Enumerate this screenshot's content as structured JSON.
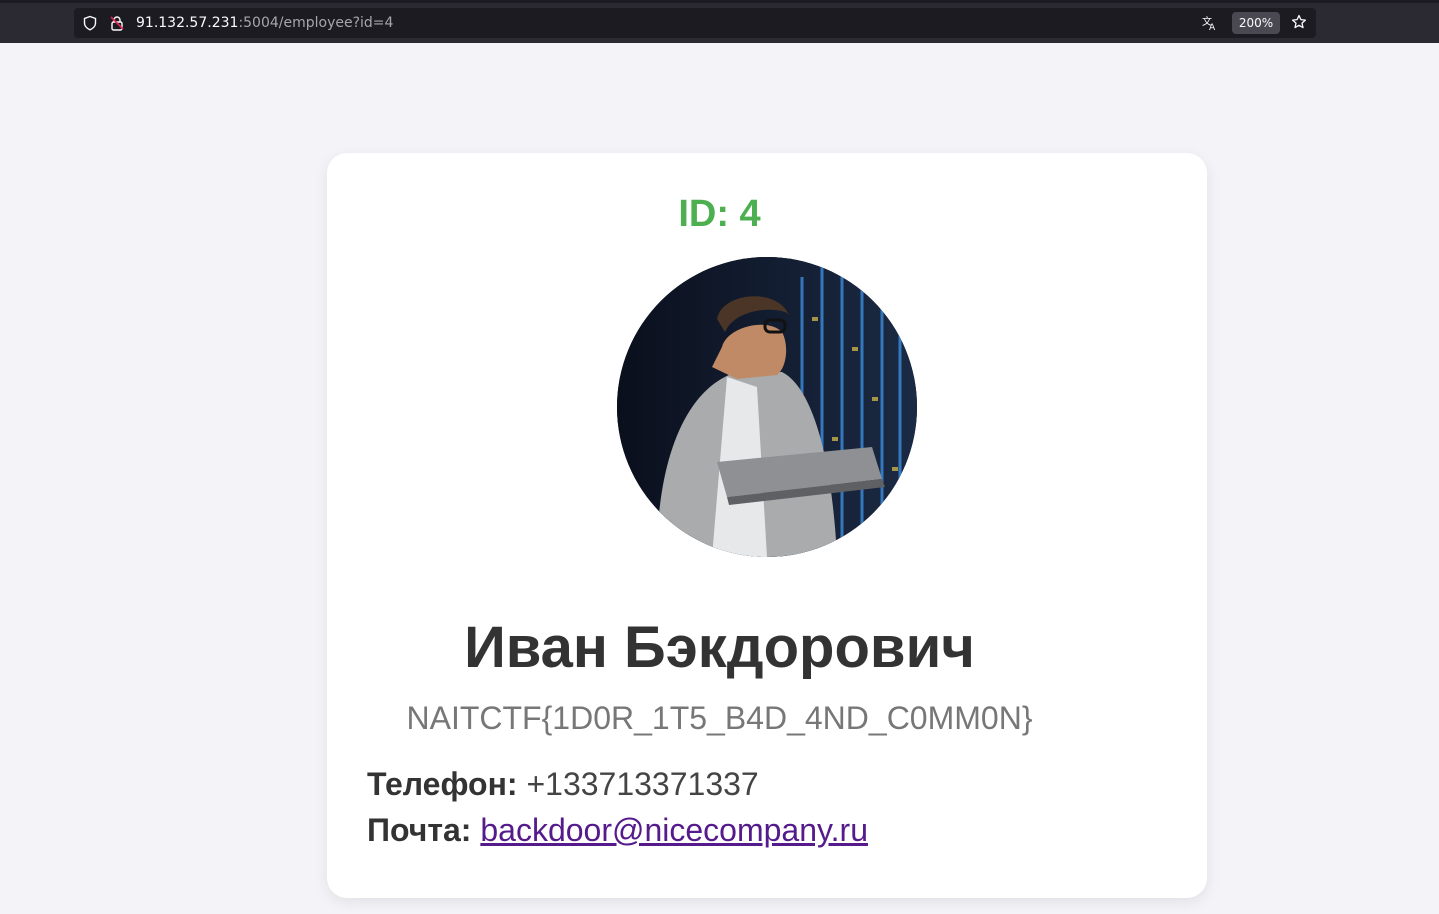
{
  "browser": {
    "url_host": "91.132.57.231",
    "url_path": ":5004/employee?id=4",
    "zoom": "200%"
  },
  "icons": {
    "shield": "shield-icon",
    "lock": "lock-insecure-icon",
    "translate": "translate-icon",
    "star": "bookmark-star-icon"
  },
  "employee": {
    "id_text": "ID: 4",
    "name": "Иван Бэкдорович",
    "flag": "NAITCTF{1D0R_1T5_B4D_4ND_C0MM0N}",
    "phone_label": "Телефон:",
    "phone": "+133713371337",
    "email_label": "Почта:",
    "email": "backdoor@nicecompany.ru"
  },
  "colors": {
    "id_accent": "#4caf50",
    "link": "#551a8b",
    "page_bg": "#f3f3f8"
  }
}
